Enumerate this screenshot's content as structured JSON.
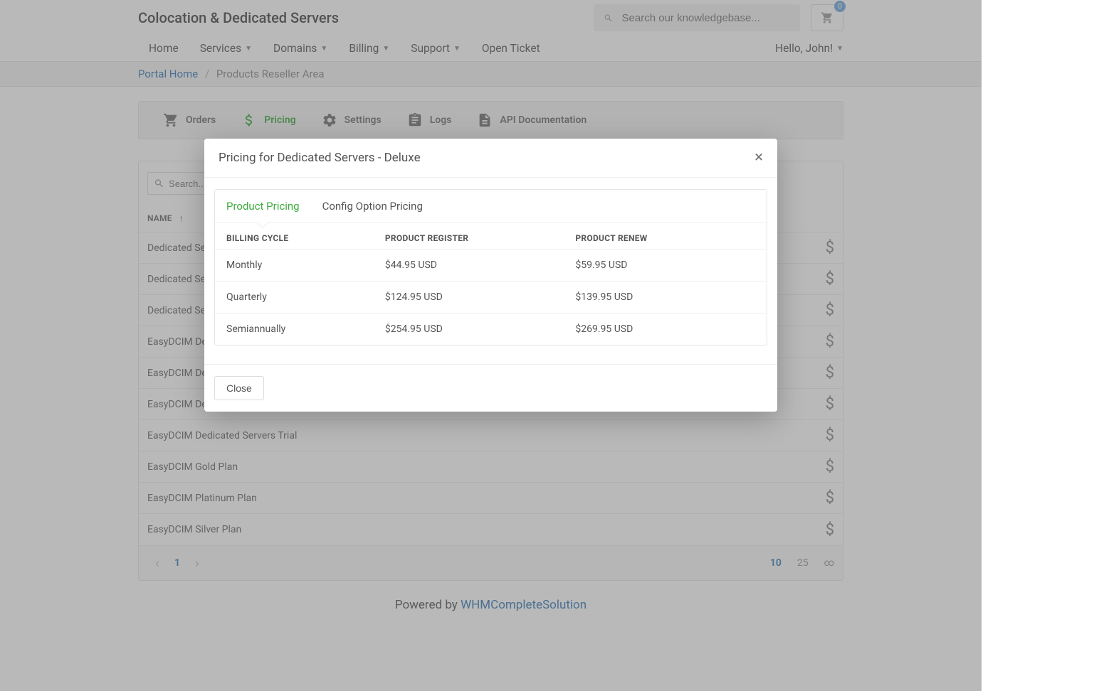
{
  "header": {
    "title": "Colocation & Dedicated Servers",
    "search_placeholder": "Search our knowledgebase...",
    "cart_count": "0"
  },
  "nav": {
    "items": [
      "Home",
      "Services",
      "Domains",
      "Billing",
      "Support",
      "Open Ticket"
    ],
    "user": "Hello, John!"
  },
  "breadcrumb": {
    "home": "Portal Home",
    "current": "Products Reseller Area"
  },
  "tabs": [
    "Orders",
    "Pricing",
    "Settings",
    "Logs",
    "API Documentation"
  ],
  "list": {
    "search_placeholder": "Search...",
    "column": "NAME",
    "rows": [
      "Dedicated Serv",
      "Dedicated Serv",
      "Dedicated Serv",
      "EasyDCIM Dedi",
      "EasyDCIM Dedi",
      "EasyDCIM Dedi",
      "EasyDCIM Dedicated Servers Trial",
      "EasyDCIM Gold Plan",
      "EasyDCIM Platinum Plan",
      "EasyDCIM Silver Plan"
    ],
    "page": "1",
    "sizes": [
      "10",
      "25",
      "∞"
    ]
  },
  "footer": {
    "text": "Powered by ",
    "link": "WHMCompleteSolution"
  },
  "modal": {
    "title": "Pricing for Dedicated Servers - Deluxe",
    "tabs": [
      "Product Pricing",
      "Config Option Pricing"
    ],
    "headers": [
      "BILLING CYCLE",
      "PRODUCT REGISTER",
      "PRODUCT RENEW"
    ],
    "rows": [
      {
        "cycle": "Monthly",
        "register": "$44.95 USD",
        "renew": "$59.95 USD"
      },
      {
        "cycle": "Quarterly",
        "register": "$124.95 USD",
        "renew": "$139.95 USD"
      },
      {
        "cycle": "Semiannually",
        "register": "$254.95 USD",
        "renew": "$269.95 USD"
      }
    ],
    "close": "Close"
  }
}
